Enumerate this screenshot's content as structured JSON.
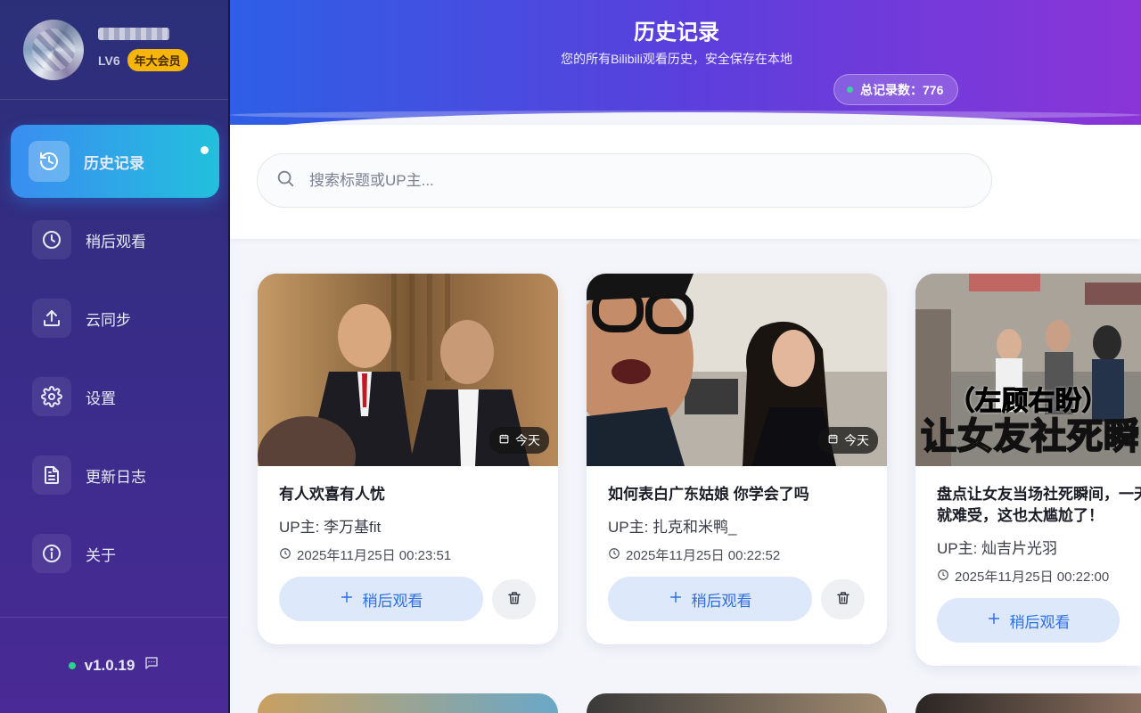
{
  "profile": {
    "level": "LV6",
    "vip_label": "年大会员"
  },
  "nav": {
    "items": [
      {
        "label": "历史记录",
        "icon": "history-icon"
      },
      {
        "label": "稍后观看",
        "icon": "clock-icon"
      },
      {
        "label": "云同步",
        "icon": "upload-icon"
      },
      {
        "label": "设置",
        "icon": "gear-icon"
      },
      {
        "label": "更新日志",
        "icon": "document-icon"
      },
      {
        "label": "关于",
        "icon": "info-icon"
      }
    ],
    "active_index": 0
  },
  "footer": {
    "version": "v1.0.19"
  },
  "header": {
    "title": "历史记录",
    "subtitle": "您的所有Bilibili观看历史，安全保存在本地",
    "total_label": "总记录数：776"
  },
  "search": {
    "placeholder": "搜索标题或UP主..."
  },
  "cards": [
    {
      "title": "有人欢喜有人忧",
      "up": "UP主: 李万基fit",
      "time": "2025年11月25日 00:23:51",
      "date_chip": "今天",
      "later_label": "稍后观看"
    },
    {
      "title": "如何表白广东姑娘 你学会了吗",
      "up": "UP主: 扎克和米鸭_",
      "time": "2025年11月25日 00:22:52",
      "date_chip": "今天",
      "later_label": "稍后观看"
    },
    {
      "title": "盘点让女友当场社死瞬间，一天剑就难受，这也太尴尬了！",
      "up": "UP主: 灿吉片光羽",
      "time": "2025年11月25日 00:22:00",
      "thumb_caption_1": "（左顾右盼）",
      "thumb_caption_2": "让女友社死瞬",
      "later_label": "稍后观看"
    }
  ],
  "colors": {
    "accent": "#2f6fe0",
    "active_nav_from": "#3a8df0",
    "active_nav_to": "#23c0dc",
    "vip": "#f5b50a"
  }
}
